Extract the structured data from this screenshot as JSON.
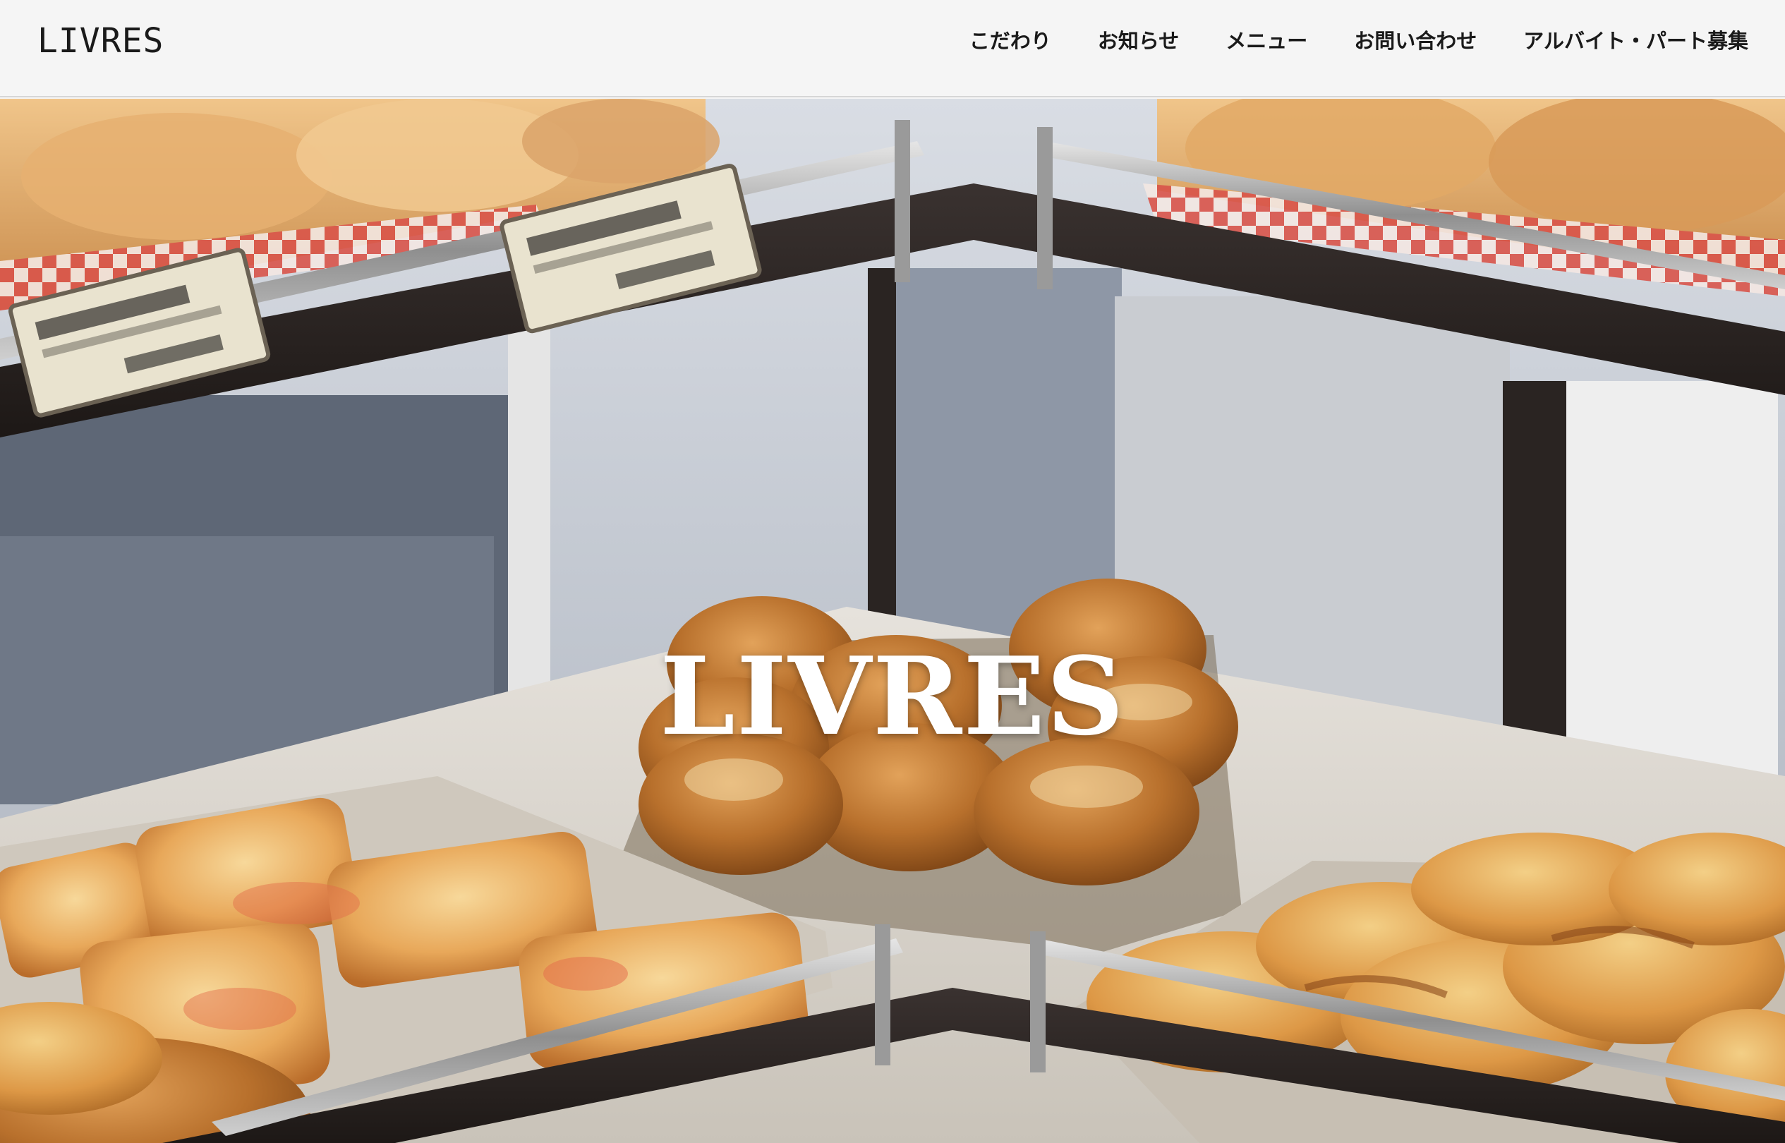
{
  "header": {
    "logo": "LIVRES",
    "nav": [
      {
        "label": "こだわり"
      },
      {
        "label": "お知らせ"
      },
      {
        "label": "メニュー"
      },
      {
        "label": "お問い合わせ"
      },
      {
        "label": "アルバイト・パート募集"
      }
    ]
  },
  "hero": {
    "title": "LIVRES",
    "image_alt": "bakery-display-case"
  },
  "colors": {
    "header_bg": "#f5f5f5",
    "text": "#1a1a1a",
    "hero_title": "#ffffff"
  }
}
